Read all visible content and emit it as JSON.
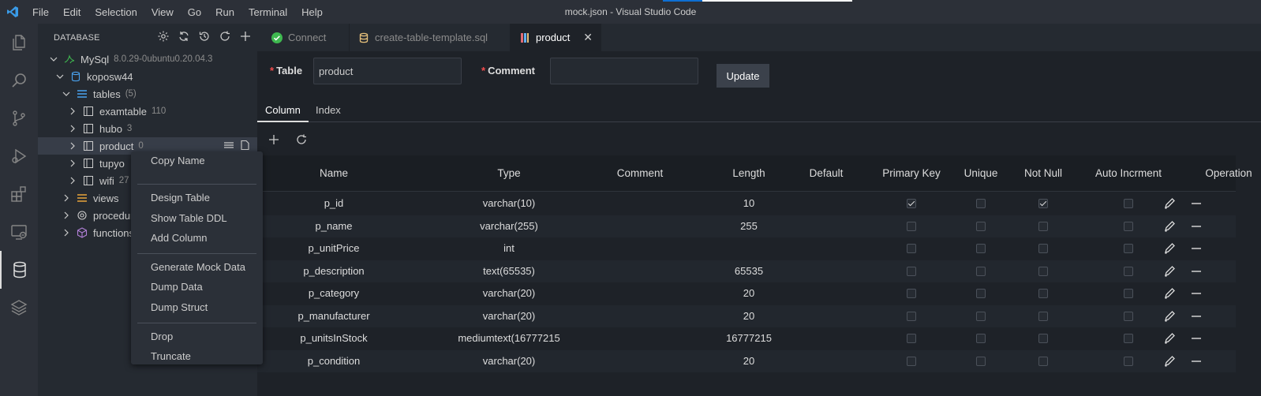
{
  "titlebar": {
    "menu": [
      "File",
      "Edit",
      "Selection",
      "View",
      "Go",
      "Run",
      "Terminal",
      "Help"
    ],
    "title": "mock.json - Visual Studio Code"
  },
  "activity": {
    "items": [
      "files-icon",
      "search-icon",
      "source-control-icon",
      "run-debug-icon",
      "extensions-icon",
      "remote-explorer-icon",
      "database-icon",
      "layers-icon"
    ],
    "active": "database-icon"
  },
  "sidebar": {
    "header": "DATABASE",
    "tree": {
      "connection": {
        "label": "MySql",
        "desc": "8.0.29-0ubuntu0.20.04.3"
      },
      "schema": {
        "label": "koposw44"
      },
      "tables_group": {
        "label": "tables",
        "desc": "(5)"
      },
      "tables": [
        {
          "label": "examtable",
          "desc": "110"
        },
        {
          "label": "hubo",
          "desc": "3"
        },
        {
          "label": "product",
          "desc": "0"
        },
        {
          "label": "tupyo",
          "desc": ""
        },
        {
          "label": "wifi",
          "desc": "27"
        }
      ],
      "views": {
        "label": "views"
      },
      "procedures": {
        "label": "procedures"
      },
      "functions": {
        "label": "functions"
      }
    }
  },
  "context_menu": {
    "groups": [
      [
        "Copy Name"
      ],
      [
        "Design Table",
        "Show Table DDL",
        "Add Column"
      ],
      [
        "Generate Mock Data",
        "Dump Data",
        "Dump Struct"
      ],
      [
        "Drop",
        "Truncate"
      ]
    ]
  },
  "tabs": [
    {
      "label": "Connect",
      "active": false
    },
    {
      "label": "create-table-template.sql",
      "active": false
    },
    {
      "label": "product",
      "active": true
    }
  ],
  "editor": {
    "table_label": "Table",
    "table_value": "product",
    "comment_label": "Comment",
    "comment_value": "",
    "update_label": "Update",
    "subtabs": [
      "Column",
      "Index"
    ],
    "columns_header": [
      "Name",
      "Type",
      "Comment",
      "Length",
      "Default",
      "Primary Key",
      "Unique",
      "Not Null",
      "Auto Incrment",
      "Operation"
    ],
    "rows": [
      {
        "name": "p_id",
        "type": "varchar(10)",
        "comment": "",
        "length": "10",
        "default": "",
        "pk": true,
        "unique": false,
        "notnull": true,
        "ai": false
      },
      {
        "name": "p_name",
        "type": "varchar(255)",
        "comment": "",
        "length": "255",
        "default": "",
        "pk": false,
        "unique": false,
        "notnull": false,
        "ai": false
      },
      {
        "name": "p_unitPrice",
        "type": "int",
        "comment": "",
        "length": "",
        "default": "",
        "pk": false,
        "unique": false,
        "notnull": false,
        "ai": false
      },
      {
        "name": "p_description",
        "type": "text(65535)",
        "comment": "",
        "length": "65535",
        "default": "",
        "pk": false,
        "unique": false,
        "notnull": false,
        "ai": false
      },
      {
        "name": "p_category",
        "type": "varchar(20)",
        "comment": "",
        "length": "20",
        "default": "",
        "pk": false,
        "unique": false,
        "notnull": false,
        "ai": false
      },
      {
        "name": "p_manufacturer",
        "type": "varchar(20)",
        "comment": "",
        "length": "20",
        "default": "",
        "pk": false,
        "unique": false,
        "notnull": false,
        "ai": false
      },
      {
        "name": "p_unitsInStock",
        "type": "mediumtext(16777215",
        "comment": "",
        "length": "16777215",
        "default": "",
        "pk": false,
        "unique": false,
        "notnull": false,
        "ai": false
      },
      {
        "name": "p_condition",
        "type": "varchar(20)",
        "comment": "",
        "length": "20",
        "default": "",
        "pk": false,
        "unique": false,
        "notnull": false,
        "ai": false
      }
    ]
  },
  "colors": {
    "accent": "#0e6fd3",
    "required": "#f14c4c",
    "connect_ok": "#3fb950"
  }
}
